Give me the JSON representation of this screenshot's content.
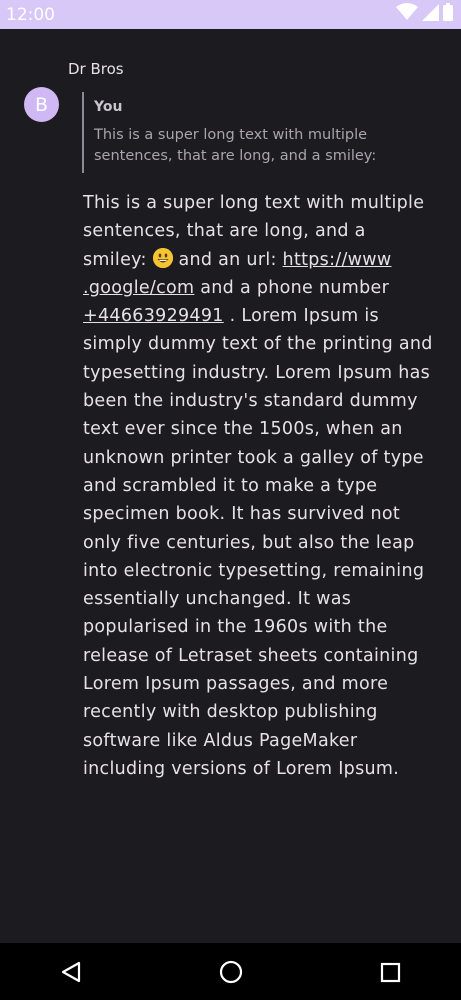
{
  "status_bar": {
    "time": "12:00",
    "icons": [
      "wifi-icon",
      "cellular-icon",
      "battery-icon"
    ]
  },
  "conversation": {
    "sender_name": "Dr Bros",
    "avatar_initial": "B",
    "reply": {
      "author": "You",
      "text": "This is a super long text with multiple sentences, that are long, and a smiley:"
    },
    "message": {
      "text_before_emoji": "This is a super long text with multiple sentences, that are long, and a smiley: ",
      "emoji": "grinning-face-emoji",
      "text_after_emoji": " and an url: ",
      "url_line1": "https://www",
      "url_line2": ".google/com",
      "text_after_url": " and a phone number ",
      "phone": "+44663929491",
      "text_after_phone": " . Lorem Ipsum is simply dummy text of the printing and typesetting industry. Lorem Ipsum has been the industry's standard dummy text ever since the 1500s, when an unknown printer took a galley of type and scrambled it to make a type specimen book. It has survived not only five centuries, but also the leap into electronic typesetting, remaining essentially unchanged. It was popularised in the 1960s with the release of Letraset sheets containing Lorem Ipsum passages, and more recently with desktop publishing software like Aldus PageMaker including versions of Lorem Ipsum."
    }
  },
  "nav_bar": {
    "buttons": [
      "back-icon",
      "home-icon",
      "recents-icon"
    ]
  },
  "colors": {
    "status_bar": "#d8c8f8",
    "background": "#1c1b1f",
    "avatar": "#cfb8f4",
    "nav_bar": "#000000"
  }
}
